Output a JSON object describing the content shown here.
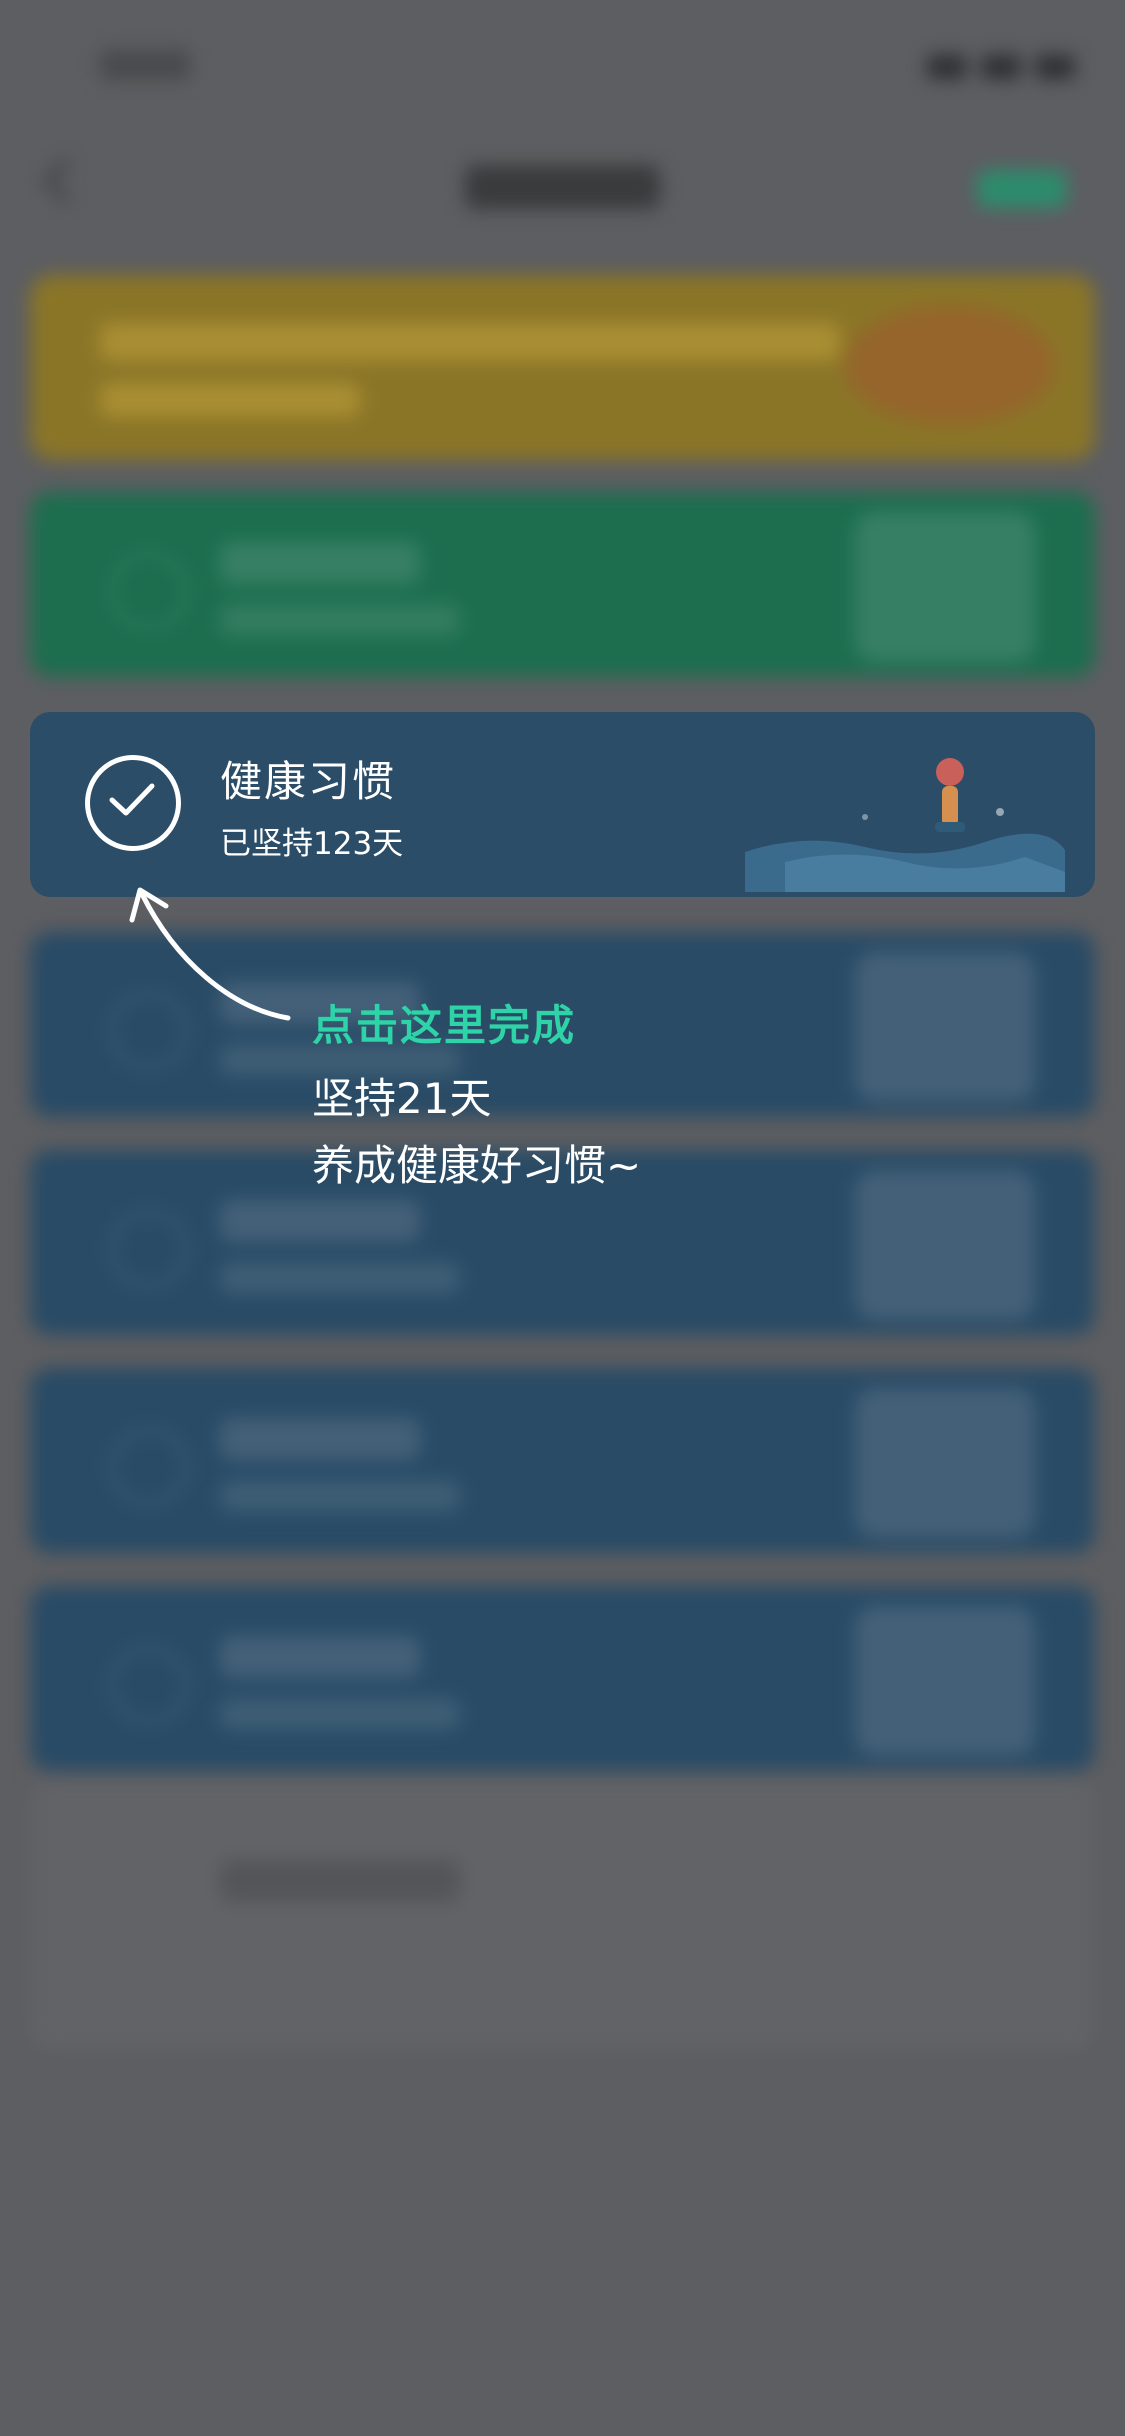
{
  "guide": {
    "habit_title": "健康习惯",
    "habit_streak": "已坚持123天",
    "tip_title": "点击这里完成",
    "tip_line1": "坚持21天",
    "tip_line2": "养成健康好习惯~"
  },
  "colors": {
    "accent": "#2ed3a7",
    "overlay": "#5d5e61",
    "card_blue": "#2b4d68",
    "card_green": "#1c6e4f",
    "banner": "#8a7527"
  },
  "icons": [
    "check-circle-icon",
    "curved-arrow-icon",
    "back-icon"
  ]
}
